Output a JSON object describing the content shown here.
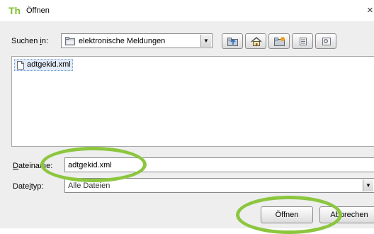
{
  "window": {
    "app_icon": "Th",
    "title": "Öffnen",
    "close_glyph": "×"
  },
  "lookin": {
    "label_pre": "Suchen ",
    "label_mnemonic": "i",
    "label_post": "n:",
    "value": "elektronische Meldungen",
    "icon": "folder-icon"
  },
  "toolbar": {
    "buttons": [
      {
        "name": "up-folder-icon"
      },
      {
        "name": "home-icon"
      },
      {
        "name": "new-folder-icon"
      },
      {
        "name": "list-view-icon"
      },
      {
        "name": "details-view-icon"
      }
    ]
  },
  "files": [
    {
      "name": "adtgekid.xml",
      "icon": "file-icon",
      "selected": true
    }
  ],
  "filename": {
    "label_mnemonic": "D",
    "label_rest": "ateiname:",
    "value": "adtgekid.xml"
  },
  "filetype": {
    "label_pre": "Date",
    "label_mnemonic": "i",
    "label_post": "typ:",
    "value": "Alle Dateien"
  },
  "buttons": {
    "open": "Öffnen",
    "cancel": "Abbrechen"
  },
  "annotations": {
    "color": "#8cc63f",
    "count": 2
  }
}
